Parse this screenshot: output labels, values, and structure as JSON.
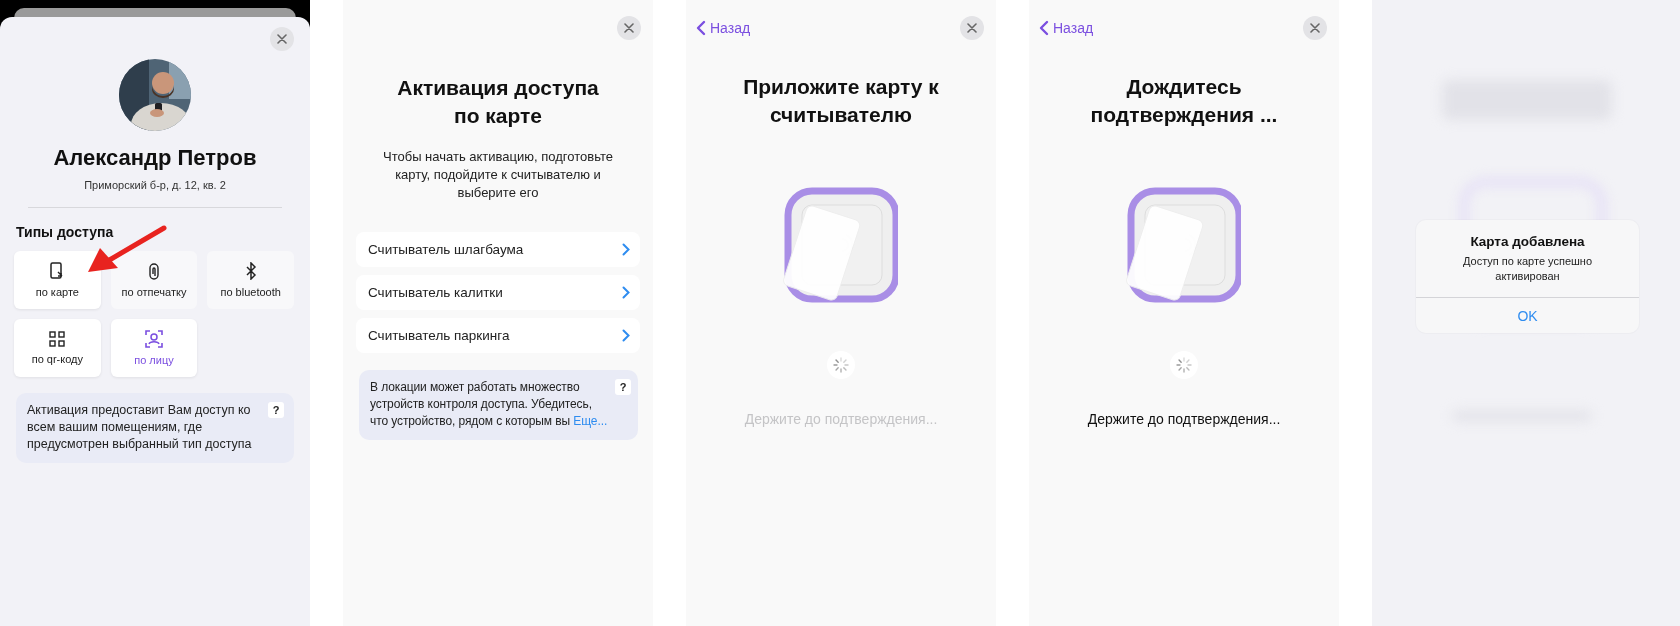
{
  "screens": [
    {
      "kind": "profile",
      "name": "Александр Петров",
      "address": "Приморский б-р, д. 12, кв. 2",
      "section_title": "Типы доступа",
      "access_types": [
        {
          "kind": "card",
          "label": "по карте",
          "disabled": false,
          "selected": false
        },
        {
          "kind": "fingerprint",
          "label": "по отпечатку",
          "disabled": true,
          "selected": false
        },
        {
          "kind": "bluetooth",
          "label": "по bluetooth",
          "disabled": true,
          "selected": false
        },
        {
          "kind": "qr",
          "label": "по qr-коду",
          "disabled": false,
          "selected": false
        },
        {
          "kind": "face",
          "label": "по лицу",
          "disabled": false,
          "selected": true
        }
      ],
      "info": {
        "text": "Активация предоставит Вам доступ ко всем вашим помещениям, где предусмотрен выбранный тип доступа",
        "help": "?"
      }
    },
    {
      "kind": "reader_select",
      "title": "Активация доступа по карте",
      "description": "Чтобы начать активацию, подготовьте карту, подойдите к считывателю и выберите его",
      "readers": [
        {
          "label": "Считыватель шлагбаума"
        },
        {
          "label": "Считыватель калитки"
        },
        {
          "label": "Считыватель паркинга"
        }
      ],
      "info": {
        "text": "В локации может работать множество устройств контроля доступа. Убедитесь, что устройство, рядом с которым вы",
        "more": "Еще...",
        "help": "?"
      }
    },
    {
      "kind": "tap_card",
      "back": "Назад",
      "title": "Приложите карту к считывателю",
      "hint": "Держите до подтверждения...",
      "hint_active": false
    },
    {
      "kind": "tap_card",
      "back": "Назад",
      "title": "Дождитесь подтверждения ...",
      "hint": "Держите до подтверждения...",
      "hint_active": true
    },
    {
      "kind": "alert",
      "alert": {
        "title": "Карта добавлена",
        "message": "Доступ по карте успешно активирован",
        "button": "OK"
      }
    }
  ]
}
